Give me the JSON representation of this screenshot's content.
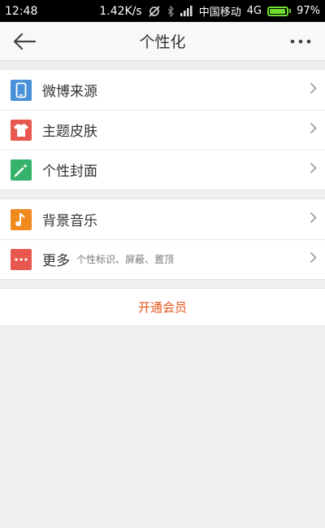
{
  "status_bar": {
    "time": "12:48",
    "speed": "1.42K/s",
    "carrier": "中国移动",
    "network": "4G",
    "battery": "97%",
    "battery_level": 0.97
  },
  "nav": {
    "title": "个性化"
  },
  "groups": [
    {
      "items": [
        {
          "label": "微博来源",
          "icon": "phone-icon",
          "color": "#4a90d9"
        },
        {
          "label": "主题皮肤",
          "icon": "shirt-icon",
          "color": "#e8584f"
        },
        {
          "label": "个性封面",
          "icon": "magic-wand-icon",
          "color": "#36b36a"
        }
      ]
    },
    {
      "items": [
        {
          "label": "背景音乐",
          "icon": "music-note-icon",
          "color": "#f08a1e"
        },
        {
          "label": "更多",
          "sub": "个性标识、屏蔽、置顶",
          "icon": "more-dots-icon",
          "color": "#e8584f"
        }
      ]
    }
  ],
  "member_button": {
    "label": "开通会员",
    "color": "#e8541e"
  }
}
